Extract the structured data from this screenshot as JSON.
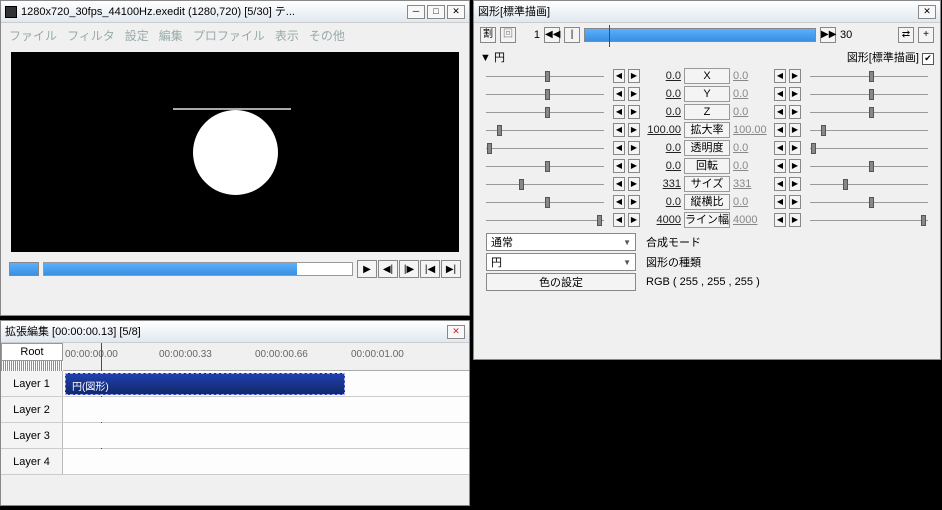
{
  "main": {
    "title": "1280x720_30fps_44100Hz.exedit (1280,720)  [5/30]  テ...",
    "menu": [
      "ファイル",
      "フィルタ",
      "設定",
      "編集",
      "プロファイル",
      "表示",
      "その他"
    ],
    "play": [
      "▶",
      "◀|",
      "|▶",
      "|◀",
      "▶|"
    ]
  },
  "timeline": {
    "title": "拡張編集  [00:00:00.13]  [5/8]",
    "root": "Root",
    "tcodes": [
      "00:00:00.00",
      "00:00:00.33",
      "00:00:00.66",
      "00:00:01.00"
    ],
    "layers": [
      "Layer  1",
      "Layer  2",
      "Layer  3",
      "Layer  4"
    ],
    "clip": "円(図形)"
  },
  "prop": {
    "title": "図形[標準描画]",
    "frame_start": "1",
    "frame_end": "30",
    "shape_name": "円",
    "header_right": "図形[標準描画]",
    "params": [
      {
        "v": "0.0",
        "l": "X",
        "v2": "0.0",
        "tl": 50,
        "tr": 50
      },
      {
        "v": "0.0",
        "l": "Y",
        "v2": "0.0",
        "tl": 50,
        "tr": 50
      },
      {
        "v": "0.0",
        "l": "Z",
        "v2": "0.0",
        "tl": 50,
        "tr": 50
      },
      {
        "v": "100.00",
        "l": "拡大率",
        "v2": "100.00",
        "tl": 13,
        "tr": 13
      },
      {
        "v": "0.0",
        "l": "透明度",
        "v2": "0.0",
        "tl": 5,
        "tr": 5
      },
      {
        "v": "0.0",
        "l": "回転",
        "v2": "0.0",
        "tl": 50,
        "tr": 50
      },
      {
        "v": "331",
        "l": "サイズ",
        "v2": "331",
        "tl": 30,
        "tr": 30
      },
      {
        "v": "0.0",
        "l": "縦横比",
        "v2": "0.0",
        "tl": 50,
        "tr": 50
      },
      {
        "v": "4000",
        "l": "ライン幅",
        "v2": "4000",
        "tl": 90,
        "tr": 90
      }
    ],
    "blend_mode_label": "合成モード",
    "blend_mode": "通常",
    "shape_type_label": "図形の種類",
    "shape_type": "円",
    "color_label": "色の設定",
    "color_value": "RGB ( 255 , 255 , 255 )"
  }
}
